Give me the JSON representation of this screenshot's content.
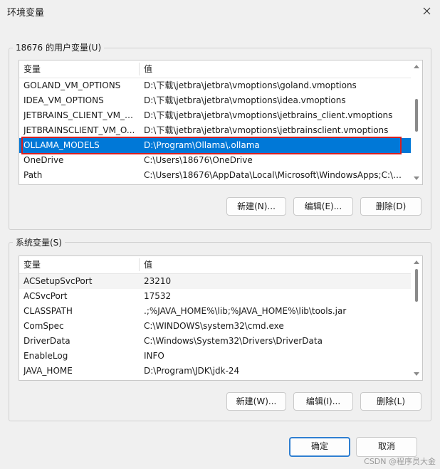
{
  "window": {
    "title": "环境变量"
  },
  "user_vars": {
    "group_label": "18676 的用户变量(U)",
    "columns": [
      "变量",
      "值"
    ],
    "rows": [
      {
        "name": "GOLAND_VM_OPTIONS",
        "value": "D:\\下载\\jetbra\\jetbra\\vmoptions\\goland.vmoptions"
      },
      {
        "name": "IDEA_VM_OPTIONS",
        "value": "D:\\下载\\jetbra\\jetbra\\vmoptions\\idea.vmoptions"
      },
      {
        "name": "JETBRAINS_CLIENT_VM_O...",
        "value": "D:\\下载\\jetbra\\jetbra\\vmoptions\\jetbrains_client.vmoptions"
      },
      {
        "name": "JETBRAINSCLIENT_VM_O...",
        "value": "D:\\下载\\jetbra\\jetbra\\vmoptions\\jetbrainsclient.vmoptions"
      },
      {
        "name": "OLLAMA_MODELS",
        "value": "D:\\Program\\Ollama\\.ollama",
        "selected": true
      },
      {
        "name": "OneDrive",
        "value": "C:\\Users\\18676\\OneDrive"
      },
      {
        "name": "Path",
        "value": "C:\\Users\\18676\\AppData\\Local\\Microsoft\\WindowsApps;C:\\U..."
      }
    ],
    "buttons": {
      "new": "新建(N)...",
      "edit": "编辑(E)...",
      "delete": "删除(D)"
    }
  },
  "system_vars": {
    "group_label": "系统变量(S)",
    "columns": [
      "变量",
      "值"
    ],
    "rows": [
      {
        "name": "ACSetupSvcPort",
        "value": "23210"
      },
      {
        "name": "ACSvcPort",
        "value": "17532"
      },
      {
        "name": "CLASSPATH",
        "value": ".;%JAVA_HOME%\\lib;%JAVA_HOME%\\lib\\tools.jar"
      },
      {
        "name": "ComSpec",
        "value": "C:\\WINDOWS\\system32\\cmd.exe"
      },
      {
        "name": "DriverData",
        "value": "C:\\Windows\\System32\\Drivers\\DriverData"
      },
      {
        "name": "EnableLog",
        "value": "INFO"
      },
      {
        "name": "JAVA_HOME",
        "value": "D:\\Program\\JDK\\jdk-24"
      }
    ],
    "buttons": {
      "new": "新建(W)...",
      "edit": "编辑(I)...",
      "delete": "删除(L)"
    }
  },
  "footer": {
    "ok": "确定",
    "cancel": "取消"
  },
  "watermark": "CSDN @程序员大金",
  "colors": {
    "selection": "#0078d7",
    "highlight_border": "#d61f1f",
    "primary_border": "#2f7fd1"
  }
}
